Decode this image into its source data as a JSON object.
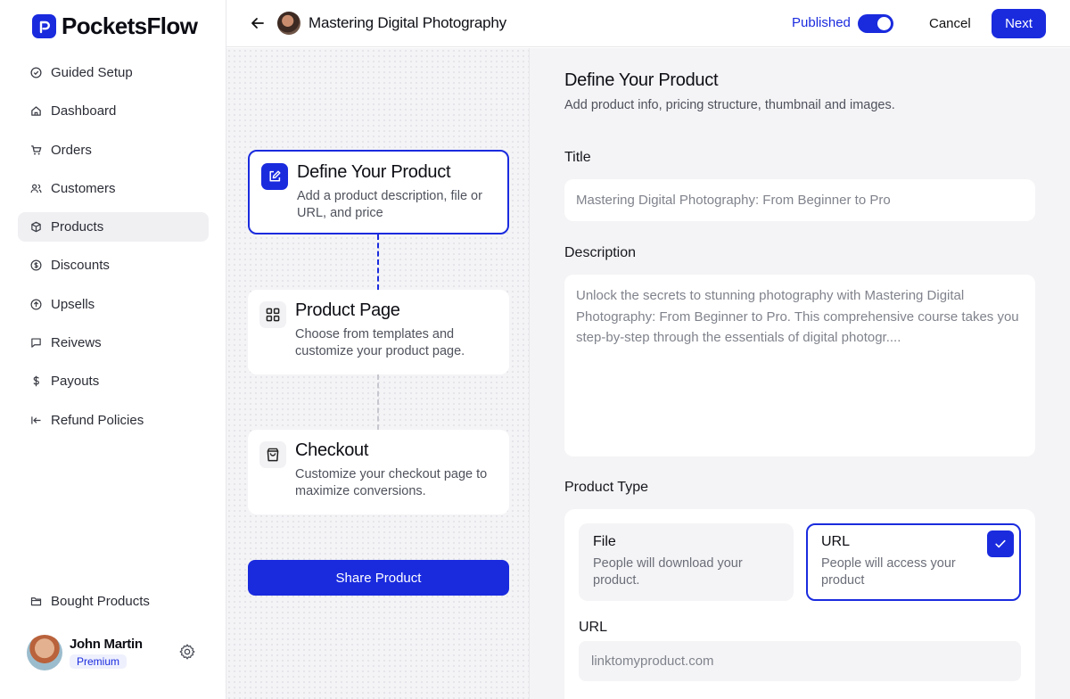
{
  "app": {
    "brand": "PocketsFlow"
  },
  "sidebar": {
    "items": [
      {
        "label": "Guided Setup",
        "icon": "check-circle-icon"
      },
      {
        "label": "Dashboard",
        "icon": "home-icon"
      },
      {
        "label": "Orders",
        "icon": "cart-icon"
      },
      {
        "label": "Customers",
        "icon": "users-icon"
      },
      {
        "label": "Products",
        "icon": "box-icon",
        "active": true
      },
      {
        "label": "Discounts",
        "icon": "discount-icon"
      },
      {
        "label": "Upsells",
        "icon": "arrow-up-circle-icon"
      },
      {
        "label": "Reivews",
        "icon": "message-icon"
      },
      {
        "label": "Payouts",
        "icon": "dollar-icon"
      },
      {
        "label": "Refund Policies",
        "icon": "return-icon"
      }
    ],
    "bottom_item": {
      "label": "Bought Products",
      "icon": "folder-icon"
    },
    "user": {
      "name": "John Martin",
      "plan": "Premium"
    }
  },
  "header": {
    "product_title": "Mastering Digital Photography",
    "published_label": "Published",
    "published": true,
    "cancel_label": "Cancel",
    "next_label": "Next"
  },
  "steps": [
    {
      "title": "Define Your Product",
      "description": "Add a product description, file or URL, and price",
      "icon": "edit-icon",
      "active": true
    },
    {
      "title": "Product Page",
      "description": "Choose from templates and customize your product page.",
      "icon": "grid-icon",
      "active": false
    },
    {
      "title": "Checkout",
      "description": "Customize your checkout page to maximize conversions.",
      "icon": "shopping-bag-icon",
      "active": false
    }
  ],
  "share_label": "Share Product",
  "form": {
    "title": "Define Your Product",
    "subtitle": "Add product info, pricing structure, thumbnail and images.",
    "title_label": "Title",
    "title_value": "Mastering Digital Photography: From Beginner to Pro",
    "description_label": "Description",
    "description_value": "Unlock the secrets to stunning photography with Mastering Digital Photography: From Beginner to Pro. This comprehensive course takes you step-by-step through the essentials of digital photogr....",
    "product_type_label": "Product Type",
    "options": [
      {
        "title": "File",
        "description": "People will download your product.",
        "selected": false
      },
      {
        "title": "URL",
        "description": "People will access your product",
        "selected": true
      }
    ],
    "url_label": "URL",
    "url_placeholder": "linktomyproduct.com"
  },
  "colors": {
    "accent": "#1a2bde",
    "panel": "#f4f4f6",
    "text": "#111827"
  }
}
